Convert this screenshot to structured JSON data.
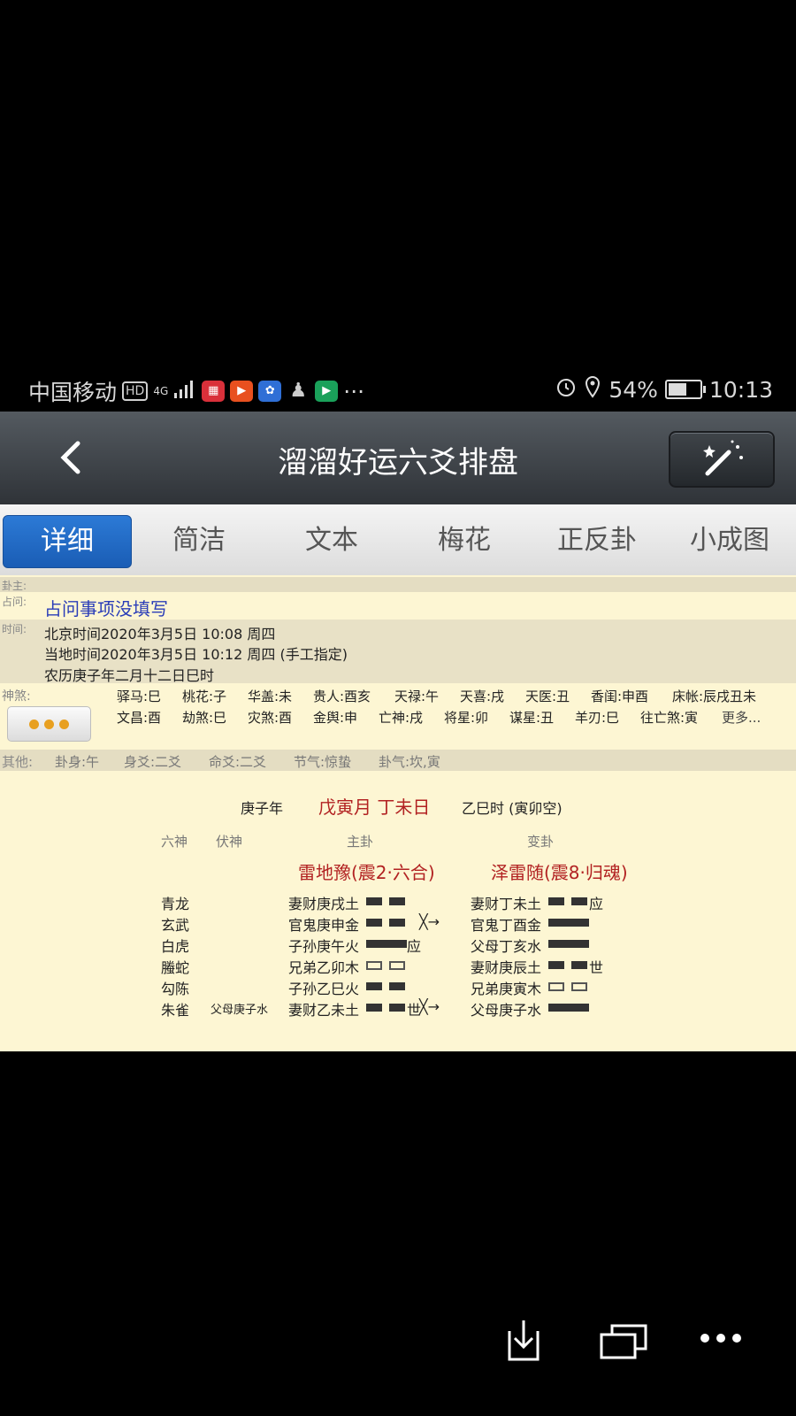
{
  "status": {
    "carrier": "中国移动",
    "hd": "HD",
    "net": "4G",
    "more": "···",
    "battery": "54%",
    "time": "10:13"
  },
  "header": {
    "title": "溜溜好运六爻排盘"
  },
  "tabs": [
    "详细",
    "简洁",
    "文本",
    "梅花",
    "正反卦",
    "小成图"
  ],
  "info": {
    "label_guazhu": "卦主:",
    "label_zhanwen": "占问:",
    "zhanwen": "占问事项没填写",
    "label_time": "时间:",
    "beijing_time": "北京时间2020年3月5日 10:08 周四",
    "local_time": "当地时间2020年3月5日 10:12 周四 (手工指定)",
    "lunar_time": "农历庚子年二月十二日巳时",
    "label_shensha": "神煞:",
    "shensha_row1": [
      "驿马:巳",
      "桃花:子",
      "华盖:未",
      "贵人:酉亥",
      "天禄:午",
      "天喜:戌",
      "天医:丑",
      "香闺:申酉",
      "床帐:辰戌丑未"
    ],
    "shensha_row2": [
      "文昌:酉",
      "劫煞:巳",
      "灾煞:酉",
      "金舆:申",
      "亡神:戌",
      "将星:卯",
      "谋星:丑",
      "羊刃:巳",
      "往亡煞:寅",
      "更多..."
    ],
    "label_other": "其他:",
    "other": [
      "卦身:午",
      "身爻:二爻",
      "命爻:二爻",
      "节气:惊蛰",
      "卦气:坎,寅"
    ]
  },
  "chart": {
    "year": "庚子年",
    "month_day": "戊寅月 丁未日",
    "hour": "乙巳时 (寅卯空)",
    "col_liushen": "六神",
    "col_fushen": "伏神",
    "col_zhugua": "主卦",
    "col_biangua": "变卦",
    "zhugua_name": "雷地豫(震2·六合)",
    "biangua_name": "泽雷随(震8·归魂)",
    "rows": [
      {
        "liushen": "青龙",
        "fushen": "",
        "main": "妻财庚戌土",
        "main_yao": "yin",
        "main_mark": "",
        "change": "",
        "bian": "妻财丁未土",
        "bian_yao": "yin",
        "bian_mark": "应"
      },
      {
        "liushen": "玄武",
        "fushen": "",
        "main": "官鬼庚申金",
        "main_yao": "yin",
        "main_mark": "",
        "change": "╳→",
        "bian": "官鬼丁酉金",
        "bian_yao": "yang",
        "bian_mark": ""
      },
      {
        "liushen": "白虎",
        "fushen": "",
        "main": "子孙庚午火",
        "main_yao": "yang",
        "main_mark": "应",
        "change": "",
        "bian": "父母丁亥水",
        "bian_yao": "yang",
        "bian_mark": ""
      },
      {
        "liushen": "螣蛇",
        "fushen": "",
        "main": "兄弟乙卯木",
        "main_yao": "yin-hollow",
        "main_mark": "",
        "change": "",
        "bian": "妻财庚辰土",
        "bian_yao": "yin",
        "bian_mark": "世"
      },
      {
        "liushen": "勾陈",
        "fushen": "",
        "main": "子孙乙巳火",
        "main_yao": "yin",
        "main_mark": "",
        "change": "",
        "bian": "兄弟庚寅木",
        "bian_yao": "yin-hollow",
        "bian_mark": ""
      },
      {
        "liushen": "朱雀",
        "fushen": "父母庚子水",
        "main": "妻财乙未土",
        "main_yao": "yin",
        "main_mark": "世",
        "change": "╳→",
        "bian": "父母庚子水",
        "bian_yao": "yang",
        "bian_mark": ""
      }
    ]
  },
  "colors": {
    "accent": "#1a5db5",
    "content_bg": "#fdf6d3",
    "red_text": "#b22222",
    "link": "#2a3db8"
  }
}
